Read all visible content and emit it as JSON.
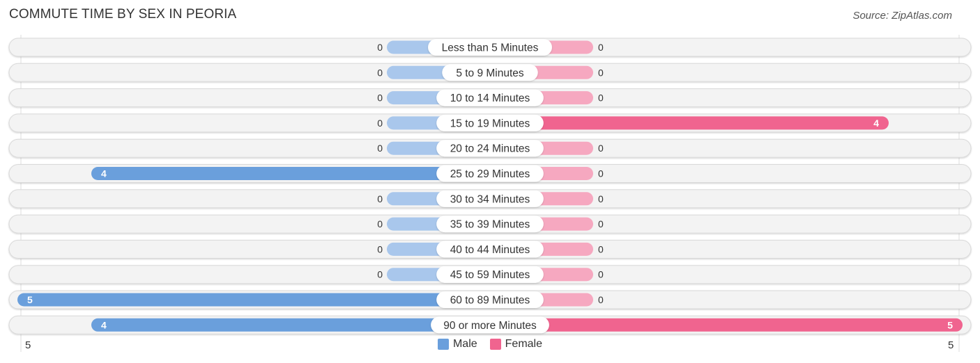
{
  "title": "COMMUTE TIME BY SEX IN PEORIA",
  "source": "Source: ZipAtlas.com",
  "legend": [
    {
      "name": "Male",
      "color": "#6a9fdc"
    },
    {
      "name": "Female",
      "color": "#f0648f"
    }
  ],
  "axis": {
    "left_label": "5",
    "right_label": "5"
  },
  "chart_data": {
    "type": "bar",
    "orientation": "horizontal-diverging",
    "title": "COMMUTE TIME BY SEX IN PEORIA",
    "categories": [
      "Less than 5 Minutes",
      "5 to 9 Minutes",
      "10 to 14 Minutes",
      "15 to 19 Minutes",
      "20 to 24 Minutes",
      "25 to 29 Minutes",
      "30 to 34 Minutes",
      "35 to 39 Minutes",
      "40 to 44 Minutes",
      "45 to 59 Minutes",
      "60 to 89 Minutes",
      "90 or more Minutes"
    ],
    "series": [
      {
        "name": "Male",
        "values": [
          0,
          0,
          0,
          0,
          0,
          4,
          0,
          0,
          0,
          0,
          5,
          4
        ]
      },
      {
        "name": "Female",
        "values": [
          0,
          0,
          0,
          4,
          0,
          0,
          0,
          0,
          0,
          0,
          0,
          5
        ]
      }
    ],
    "xlim": [
      0,
      5
    ],
    "tick_labels": {
      "left": "5",
      "right": "5"
    },
    "legend_position": "bottom-center",
    "colors": {
      "male_strong": "#6a9fdc",
      "male_light": "#a9c7ec",
      "female_strong": "#f0648f",
      "female_light": "#f6a8c0",
      "track": "#f3f3f3"
    }
  }
}
